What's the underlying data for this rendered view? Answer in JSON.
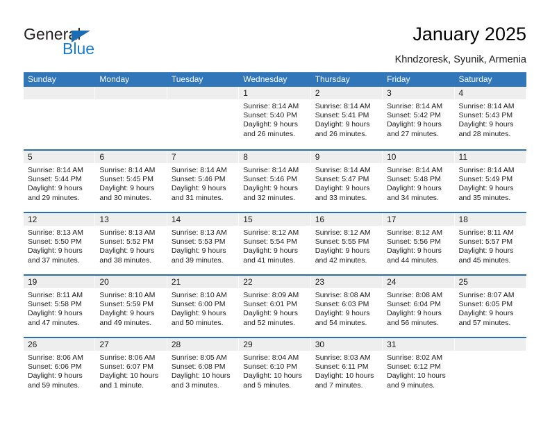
{
  "brand": {
    "name_part1": "General",
    "name_part2": "Blue",
    "triangle_color": "#1b6cb5",
    "blue_color": "#1b79c9"
  },
  "header": {
    "title": "January 2025",
    "subtitle": "Khndzoresk, Syunik, Armenia"
  },
  "theme": {
    "header_blue": "#3076b8",
    "row_line_blue": "#2b6cab",
    "day_band_gray": "#eeeeee"
  },
  "calendar": {
    "weekdays": [
      "Sunday",
      "Monday",
      "Tuesday",
      "Wednesday",
      "Thursday",
      "Friday",
      "Saturday"
    ],
    "weeks": [
      [
        {
          "day": "",
          "empty": true
        },
        {
          "day": "",
          "empty": true
        },
        {
          "day": "",
          "empty": true
        },
        {
          "day": "1",
          "sunrise": "Sunrise: 8:14 AM",
          "sunset": "Sunset: 5:40 PM",
          "daylight1": "Daylight: 9 hours",
          "daylight2": "and 26 minutes."
        },
        {
          "day": "2",
          "sunrise": "Sunrise: 8:14 AM",
          "sunset": "Sunset: 5:41 PM",
          "daylight1": "Daylight: 9 hours",
          "daylight2": "and 26 minutes."
        },
        {
          "day": "3",
          "sunrise": "Sunrise: 8:14 AM",
          "sunset": "Sunset: 5:42 PM",
          "daylight1": "Daylight: 9 hours",
          "daylight2": "and 27 minutes."
        },
        {
          "day": "4",
          "sunrise": "Sunrise: 8:14 AM",
          "sunset": "Sunset: 5:43 PM",
          "daylight1": "Daylight: 9 hours",
          "daylight2": "and 28 minutes."
        }
      ],
      [
        {
          "day": "5",
          "sunrise": "Sunrise: 8:14 AM",
          "sunset": "Sunset: 5:44 PM",
          "daylight1": "Daylight: 9 hours",
          "daylight2": "and 29 minutes."
        },
        {
          "day": "6",
          "sunrise": "Sunrise: 8:14 AM",
          "sunset": "Sunset: 5:45 PM",
          "daylight1": "Daylight: 9 hours",
          "daylight2": "and 30 minutes."
        },
        {
          "day": "7",
          "sunrise": "Sunrise: 8:14 AM",
          "sunset": "Sunset: 5:46 PM",
          "daylight1": "Daylight: 9 hours",
          "daylight2": "and 31 minutes."
        },
        {
          "day": "8",
          "sunrise": "Sunrise: 8:14 AM",
          "sunset": "Sunset: 5:46 PM",
          "daylight1": "Daylight: 9 hours",
          "daylight2": "and 32 minutes."
        },
        {
          "day": "9",
          "sunrise": "Sunrise: 8:14 AM",
          "sunset": "Sunset: 5:47 PM",
          "daylight1": "Daylight: 9 hours",
          "daylight2": "and 33 minutes."
        },
        {
          "day": "10",
          "sunrise": "Sunrise: 8:14 AM",
          "sunset": "Sunset: 5:48 PM",
          "daylight1": "Daylight: 9 hours",
          "daylight2": "and 34 minutes."
        },
        {
          "day": "11",
          "sunrise": "Sunrise: 8:14 AM",
          "sunset": "Sunset: 5:49 PM",
          "daylight1": "Daylight: 9 hours",
          "daylight2": "and 35 minutes."
        }
      ],
      [
        {
          "day": "12",
          "sunrise": "Sunrise: 8:13 AM",
          "sunset": "Sunset: 5:50 PM",
          "daylight1": "Daylight: 9 hours",
          "daylight2": "and 37 minutes."
        },
        {
          "day": "13",
          "sunrise": "Sunrise: 8:13 AM",
          "sunset": "Sunset: 5:52 PM",
          "daylight1": "Daylight: 9 hours",
          "daylight2": "and 38 minutes."
        },
        {
          "day": "14",
          "sunrise": "Sunrise: 8:13 AM",
          "sunset": "Sunset: 5:53 PM",
          "daylight1": "Daylight: 9 hours",
          "daylight2": "and 39 minutes."
        },
        {
          "day": "15",
          "sunrise": "Sunrise: 8:12 AM",
          "sunset": "Sunset: 5:54 PM",
          "daylight1": "Daylight: 9 hours",
          "daylight2": "and 41 minutes."
        },
        {
          "day": "16",
          "sunrise": "Sunrise: 8:12 AM",
          "sunset": "Sunset: 5:55 PM",
          "daylight1": "Daylight: 9 hours",
          "daylight2": "and 42 minutes."
        },
        {
          "day": "17",
          "sunrise": "Sunrise: 8:12 AM",
          "sunset": "Sunset: 5:56 PM",
          "daylight1": "Daylight: 9 hours",
          "daylight2": "and 44 minutes."
        },
        {
          "day": "18",
          "sunrise": "Sunrise: 8:11 AM",
          "sunset": "Sunset: 5:57 PM",
          "daylight1": "Daylight: 9 hours",
          "daylight2": "and 45 minutes."
        }
      ],
      [
        {
          "day": "19",
          "sunrise": "Sunrise: 8:11 AM",
          "sunset": "Sunset: 5:58 PM",
          "daylight1": "Daylight: 9 hours",
          "daylight2": "and 47 minutes."
        },
        {
          "day": "20",
          "sunrise": "Sunrise: 8:10 AM",
          "sunset": "Sunset: 5:59 PM",
          "daylight1": "Daylight: 9 hours",
          "daylight2": "and 49 minutes."
        },
        {
          "day": "21",
          "sunrise": "Sunrise: 8:10 AM",
          "sunset": "Sunset: 6:00 PM",
          "daylight1": "Daylight: 9 hours",
          "daylight2": "and 50 minutes."
        },
        {
          "day": "22",
          "sunrise": "Sunrise: 8:09 AM",
          "sunset": "Sunset: 6:01 PM",
          "daylight1": "Daylight: 9 hours",
          "daylight2": "and 52 minutes."
        },
        {
          "day": "23",
          "sunrise": "Sunrise: 8:08 AM",
          "sunset": "Sunset: 6:03 PM",
          "daylight1": "Daylight: 9 hours",
          "daylight2": "and 54 minutes."
        },
        {
          "day": "24",
          "sunrise": "Sunrise: 8:08 AM",
          "sunset": "Sunset: 6:04 PM",
          "daylight1": "Daylight: 9 hours",
          "daylight2": "and 56 minutes."
        },
        {
          "day": "25",
          "sunrise": "Sunrise: 8:07 AM",
          "sunset": "Sunset: 6:05 PM",
          "daylight1": "Daylight: 9 hours",
          "daylight2": "and 57 minutes."
        }
      ],
      [
        {
          "day": "26",
          "sunrise": "Sunrise: 8:06 AM",
          "sunset": "Sunset: 6:06 PM",
          "daylight1": "Daylight: 9 hours",
          "daylight2": "and 59 minutes."
        },
        {
          "day": "27",
          "sunrise": "Sunrise: 8:06 AM",
          "sunset": "Sunset: 6:07 PM",
          "daylight1": "Daylight: 10 hours",
          "daylight2": "and 1 minute."
        },
        {
          "day": "28",
          "sunrise": "Sunrise: 8:05 AM",
          "sunset": "Sunset: 6:08 PM",
          "daylight1": "Daylight: 10 hours",
          "daylight2": "and 3 minutes."
        },
        {
          "day": "29",
          "sunrise": "Sunrise: 8:04 AM",
          "sunset": "Sunset: 6:10 PM",
          "daylight1": "Daylight: 10 hours",
          "daylight2": "and 5 minutes."
        },
        {
          "day": "30",
          "sunrise": "Sunrise: 8:03 AM",
          "sunset": "Sunset: 6:11 PM",
          "daylight1": "Daylight: 10 hours",
          "daylight2": "and 7 minutes."
        },
        {
          "day": "31",
          "sunrise": "Sunrise: 8:02 AM",
          "sunset": "Sunset: 6:12 PM",
          "daylight1": "Daylight: 10 hours",
          "daylight2": "and 9 minutes."
        },
        {
          "day": "",
          "empty": true
        }
      ]
    ]
  }
}
